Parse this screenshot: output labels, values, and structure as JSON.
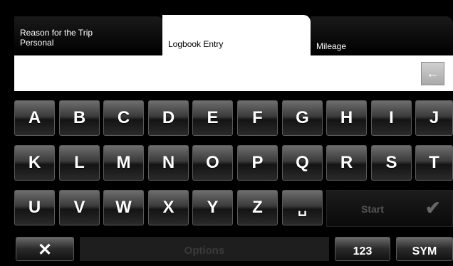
{
  "tabs": {
    "reason": {
      "title": "Reason for the Trip",
      "value": "Personal"
    },
    "logbook": {
      "title": "Logbook Entry"
    },
    "mileage": {
      "title": "Mileage"
    }
  },
  "entry": {
    "value": ""
  },
  "icons": {
    "backspace": "left-arrow-icon",
    "confirm": "checkmark-icon",
    "cancel": "x-icon",
    "space": "space-bar-icon"
  },
  "keyboard": {
    "row1": [
      "A",
      "B",
      "C",
      "D",
      "E",
      "F",
      "G",
      "H",
      "I",
      "J"
    ],
    "row2": [
      "K",
      "L",
      "M",
      "N",
      "O",
      "P",
      "Q",
      "R",
      "S",
      "T"
    ],
    "row3": [
      "U",
      "V",
      "W",
      "X",
      "Y",
      "Z",
      "␣"
    ]
  },
  "buttons": {
    "start": "Start",
    "cancel": "✕",
    "options": "Options",
    "numeric": "123",
    "symbols": "SYM"
  }
}
